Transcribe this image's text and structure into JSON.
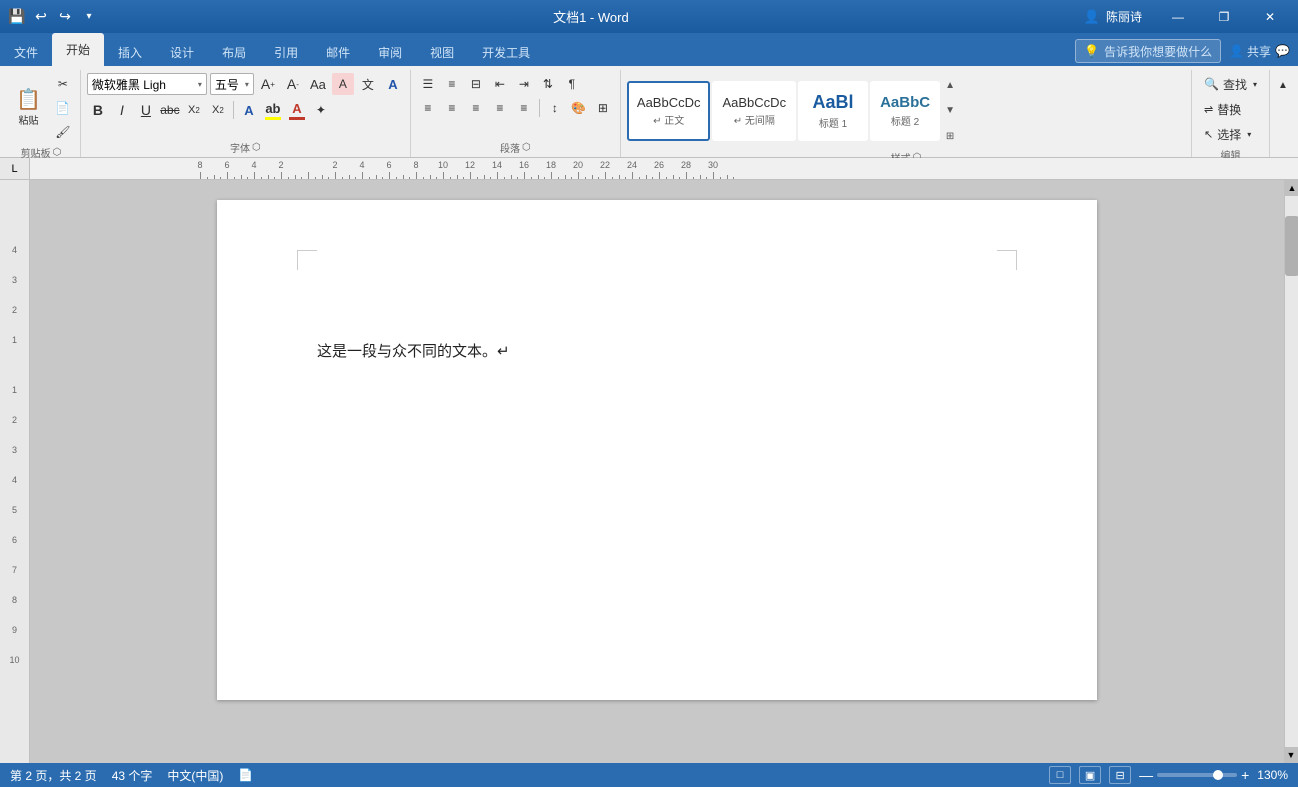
{
  "titleBar": {
    "saveIcon": "💾",
    "undoIcon": "↩",
    "redoIcon": "↪",
    "moreIcon": "▾",
    "title": "文档1 - Word",
    "userIcon": "👤",
    "userName": "陈丽诗",
    "minIcon": "—",
    "restoreIcon": "❐",
    "closeIcon": "✕"
  },
  "ribbonTabs": {
    "tabs": [
      "文件",
      "开始",
      "插入",
      "设计",
      "布局",
      "引用",
      "邮件",
      "审阅",
      "视图",
      "开发工具"
    ],
    "activeTab": "开始",
    "searchPlaceholder": "告诉我你想要做什么",
    "shareLabel": "共享"
  },
  "ribbon": {
    "clipboardGroup": {
      "label": "剪贴板",
      "pasteLabel": "粘贴",
      "cutLabel": "剪切",
      "copyLabel": "复制",
      "formatPaintLabel": "格式刷"
    },
    "fontGroup": {
      "label": "字体",
      "fontName": "微软雅黑 Ligh",
      "fontSize": "五号",
      "boldLabel": "B",
      "italicLabel": "I",
      "underlineLabel": "U",
      "strikeLabel": "abc",
      "subLabel": "X₂",
      "superLabel": "X²"
    },
    "paragraphGroup": {
      "label": "段落"
    },
    "stylesGroup": {
      "label": "样式",
      "styles": [
        {
          "name": "正文",
          "preview": "AaBbCcDc",
          "active": true
        },
        {
          "name": "无间隔",
          "preview": "AaBbCcDc",
          "active": false
        },
        {
          "name": "标题 1",
          "preview": "AaBl",
          "active": false
        },
        {
          "name": "标题 2",
          "preview": "AaBbC",
          "active": false
        }
      ]
    },
    "editingGroup": {
      "label": "编辑",
      "findLabel": "查找",
      "replaceLabel": "替换",
      "selectLabel": "选择"
    }
  },
  "document": {
    "content": "这是一段与众不同的文本。↵"
  },
  "statusBar": {
    "pageInfo": "第 2 页，共 2 页",
    "wordCount": "43 个字",
    "language": "中文(中国)",
    "docIcon": "📄",
    "readMode": "□",
    "printLayout": "▣",
    "web": "🌐",
    "zoomLevel": "130%"
  }
}
